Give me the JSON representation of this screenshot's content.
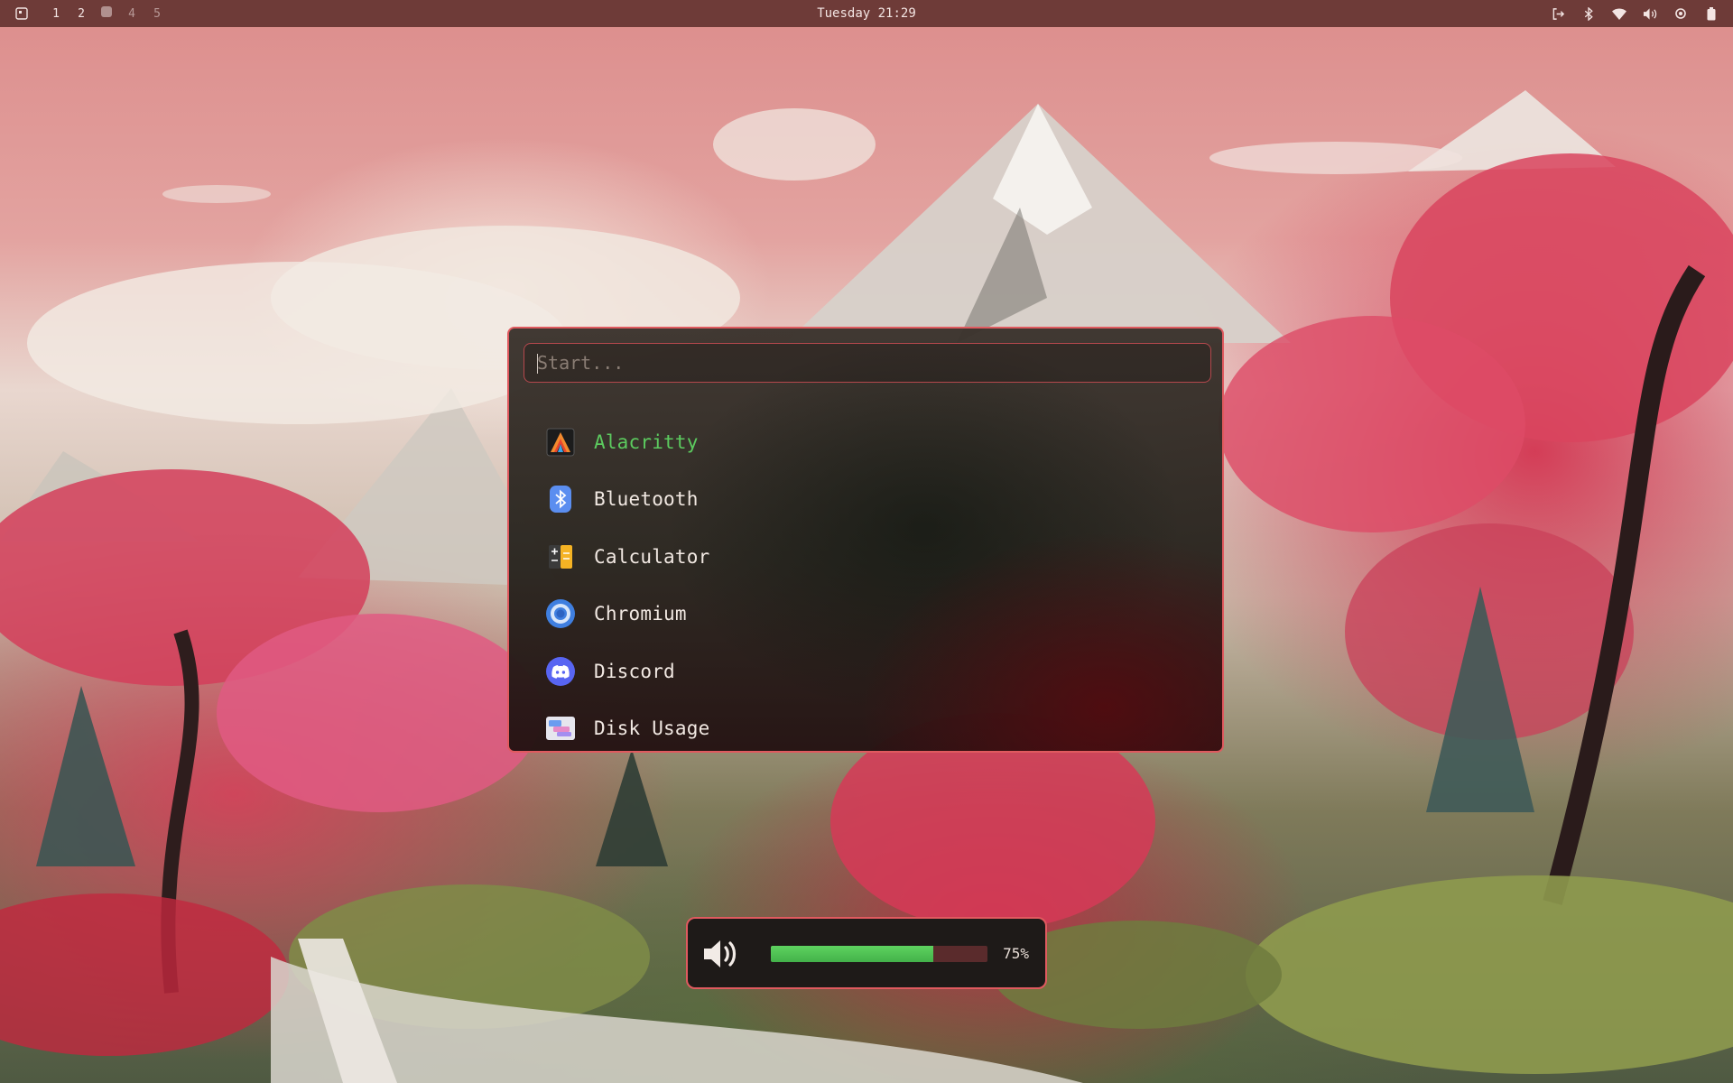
{
  "topbar": {
    "workspaces": [
      {
        "label": "1",
        "active": false,
        "occupied": true
      },
      {
        "label": "2",
        "active": false,
        "occupied": true
      },
      {
        "label": "",
        "active": true,
        "occupied": true
      },
      {
        "label": "4",
        "active": false,
        "occupied": false
      },
      {
        "label": "5",
        "active": false,
        "occupied": false
      }
    ],
    "clock": "Tuesday 21:29",
    "tray_icons": [
      "logout-icon",
      "bluetooth-icon",
      "wifi-icon",
      "volume-icon",
      "settings-icon",
      "battery-icon"
    ]
  },
  "launcher": {
    "search": {
      "placeholder": "Start...",
      "value": ""
    },
    "results": [
      {
        "label": "Alacritty",
        "icon": "alacritty-icon",
        "selected": true
      },
      {
        "label": "Bluetooth",
        "icon": "bluetooth-app-icon",
        "selected": false
      },
      {
        "label": "Calculator",
        "icon": "calculator-icon",
        "selected": false
      },
      {
        "label": "Chromium",
        "icon": "chromium-icon",
        "selected": false
      },
      {
        "label": "Discord",
        "icon": "discord-icon",
        "selected": false
      },
      {
        "label": "Disk Usage",
        "icon": "disk-usage-icon",
        "selected": false
      }
    ],
    "colors": {
      "border": "#e05a5f",
      "selected_text": "#5ccb5f",
      "text": "#f1e8e2"
    }
  },
  "volume_osd": {
    "level": 0.75,
    "label": "75%",
    "colors": {
      "fill": "#4fc052",
      "track": "#5a2b2c"
    }
  }
}
